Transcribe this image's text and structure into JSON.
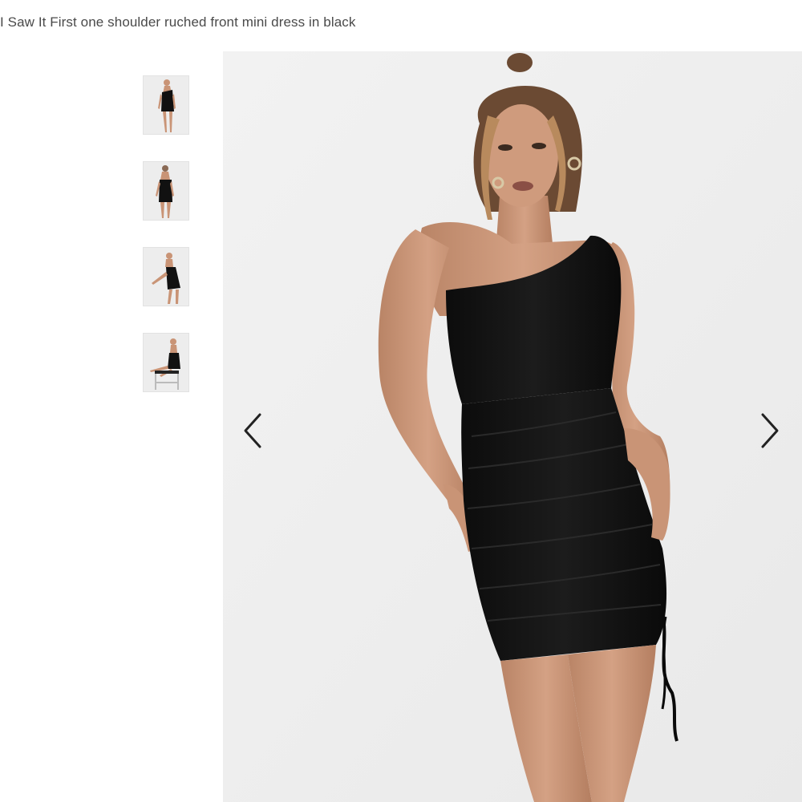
{
  "product": {
    "title": "I Saw It First one shoulder ruched front mini dress in black"
  },
  "gallery": {
    "thumbnails": [
      {
        "view": "front"
      },
      {
        "view": "back"
      },
      {
        "view": "side-seated"
      },
      {
        "view": "chair-seated"
      }
    ],
    "prev_icon": "chevron-left-icon",
    "next_icon": "chevron-right-icon"
  },
  "colors": {
    "title_text": "#4a4a4a",
    "background": "#ffffff",
    "image_bg": "#f0f0f0",
    "dress": "#111111",
    "skin": "#c99476",
    "arrow": "#222222"
  }
}
